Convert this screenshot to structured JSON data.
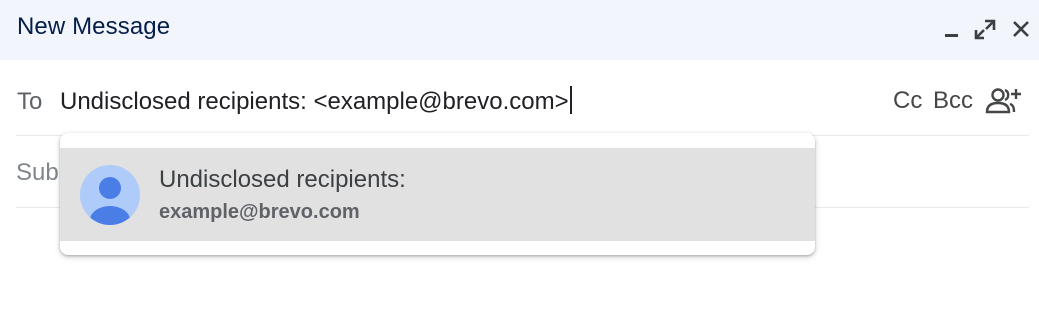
{
  "header": {
    "title": "New Message"
  },
  "window_controls": {
    "minimize_icon": "minimize-icon",
    "expand_icon": "expand-icon",
    "close_icon": "close-icon"
  },
  "to_field": {
    "label": "To",
    "value": "Undisclosed recipients: <example@brevo.com>",
    "cc_label": "Cc",
    "bcc_label": "Bcc",
    "add_recipients_icon": "add-recipients-icon"
  },
  "subject_field": {
    "label": "Sub"
  },
  "suggestion": {
    "name": "Undisclosed recipients:",
    "email": "example@brevo.com",
    "avatar_icon": "person-avatar-icon"
  },
  "colors": {
    "header_bg": "#f2f6fc",
    "title": "#041e49",
    "highlight_bg": "#e1e1e1",
    "avatar_bg": "#aecbfa",
    "avatar_fg": "#4a7ee6"
  }
}
